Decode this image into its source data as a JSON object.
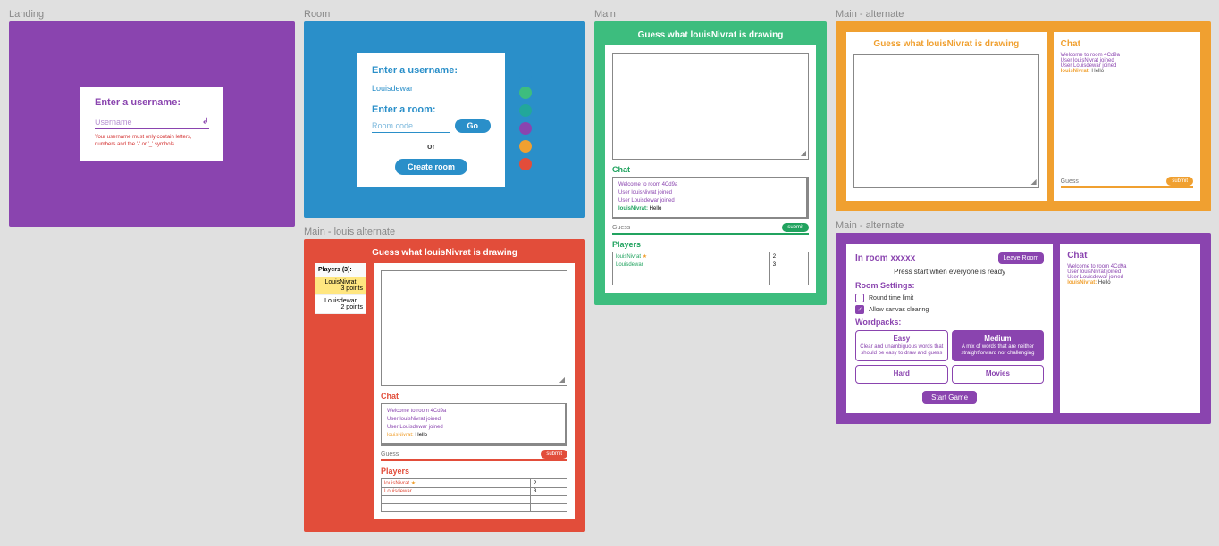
{
  "frames": {
    "landing": {
      "label": "Landing"
    },
    "room": {
      "label": "Room"
    },
    "main": {
      "label": "Main"
    },
    "main_alt_o": {
      "label": "Main - alternate"
    },
    "main_louis": {
      "label": "Main - louis alternate"
    },
    "main_alt_p": {
      "label": "Main - alternate"
    }
  },
  "landing": {
    "title": "Enter a username:",
    "placeholder": "Username",
    "error": "Your username must only contain letters, numbers and the '-' or '_' symbols"
  },
  "room": {
    "user_label": "Enter a username:",
    "user_value": "Louisdewar",
    "room_label": "Enter a room:",
    "room_placeholder": "Room code",
    "go": "Go",
    "or": "or",
    "create": "Create room",
    "palette": [
      "#2a8fc9",
      "#3dbd7e",
      "#22a79a",
      "#8a44af",
      "#f0a030",
      "#e24d3a"
    ]
  },
  "common": {
    "drawing_title": "Guess what louisNivrat is drawing",
    "chat_h": "Chat",
    "players_h": "Players",
    "guess_ph": "Guess",
    "submit": "submit",
    "chat": {
      "welcome": "Welcome to room 4Cd9a",
      "j1": "User louisNivrat joined",
      "j2": "User Louisdewar joined",
      "msg_user": "louisNivrat:",
      "msg_text": " Hello"
    }
  },
  "mlouis": {
    "players_head": "Players (3):",
    "p1": {
      "name": "LouisNivrat",
      "pts": "3 points"
    },
    "p2": {
      "name": "Louisdewar",
      "pts": "2 points"
    },
    "ptable": {
      "r1": {
        "name": "louisNivrat",
        "star": "★",
        "score": "2"
      },
      "r2": {
        "name": "Louisdewar",
        "score": "3"
      }
    }
  },
  "mpurp": {
    "room_title": "In room xxxxx",
    "leave": "Leave Room",
    "ready": "Press start when everyone is ready",
    "settings_h": "Room Settings:",
    "opt1": "Round time limit",
    "opt2": "Allow canvas clearing",
    "wp_h": "Wordpacks:",
    "easy": {
      "t": "Easy",
      "d": "Clear and unambiguous words that should be easy to draw and guess"
    },
    "medium": {
      "t": "Medium",
      "d": "A mix of words that are neither straightforward nor challenging"
    },
    "hard": {
      "t": "Hard",
      "d": ""
    },
    "movies": {
      "t": "Movies",
      "d": ""
    },
    "start": "Start Game"
  }
}
